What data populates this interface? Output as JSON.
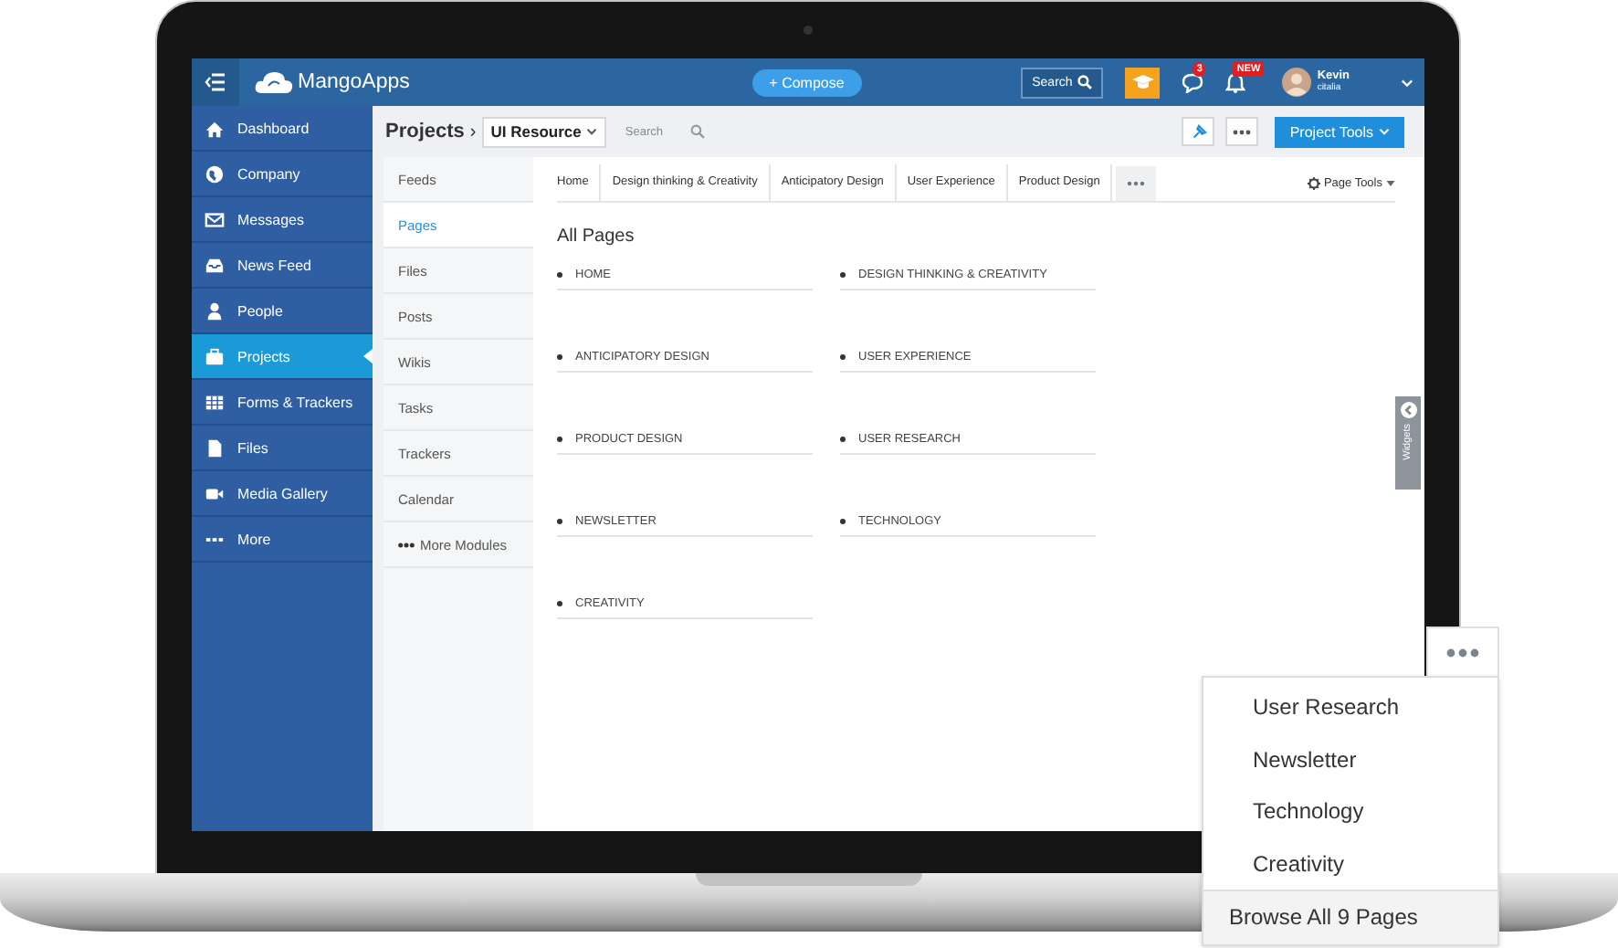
{
  "topbar": {
    "logo": "MangoApps",
    "compose": "+ Compose",
    "search": "Search",
    "chat_badge": "3",
    "new_badge": "NEW",
    "user": {
      "name": "Kevin",
      "subtitle": "citalia"
    }
  },
  "sidebar": {
    "items": [
      {
        "label": "Dashboard",
        "selected": false
      },
      {
        "label": "Company",
        "selected": false
      },
      {
        "label": "Messages",
        "selected": false
      },
      {
        "label": "News Feed",
        "selected": false
      },
      {
        "label": "People",
        "selected": false
      },
      {
        "label": "Projects",
        "selected": true
      },
      {
        "label": "Forms & Trackers",
        "selected": false
      },
      {
        "label": "Files",
        "selected": false
      },
      {
        "label": "Media Gallery",
        "selected": false
      },
      {
        "label": "More",
        "selected": false
      }
    ]
  },
  "project_bar": {
    "title": "Projects",
    "separator": "›",
    "project": "UI Resource",
    "search_placeholder": "Search",
    "tools": "Project Tools"
  },
  "modules": [
    {
      "label": "Feeds",
      "selected": false,
      "kind": "item"
    },
    {
      "label": "Pages",
      "selected": true,
      "kind": "item"
    },
    {
      "label": "Files",
      "selected": false,
      "kind": "item"
    },
    {
      "label": "Posts",
      "selected": false,
      "kind": "item"
    },
    {
      "label": "Wikis",
      "selected": false,
      "kind": "item"
    },
    {
      "label": "Tasks",
      "selected": false,
      "kind": "item"
    },
    {
      "label": "Trackers",
      "selected": false,
      "kind": "item"
    },
    {
      "label": "Calendar",
      "selected": false,
      "kind": "item"
    },
    {
      "label": "More Modules",
      "selected": false,
      "kind": "more"
    }
  ],
  "page_tabs": [
    "Home",
    "Design thinking & Creativity",
    "Anticipatory Design",
    "User Experience",
    "Product Design"
  ],
  "page_tools": "Page Tools",
  "heading": "All Pages",
  "pages": [
    "HOME",
    "DESIGN THINKING & CREATIVITY",
    "ANTICIPATORY DESIGN",
    "USER EXPERIENCE",
    "PRODUCT DESIGN",
    "USER RESEARCH",
    "NEWSLETTER",
    "TECHNOLOGY",
    "CREATIVITY"
  ],
  "widgets": "Widgets",
  "overflow_menu": {
    "items": [
      "User Research",
      "Newsletter",
      "Technology",
      "Creativity"
    ],
    "footer": "Browse All 9 Pages"
  }
}
